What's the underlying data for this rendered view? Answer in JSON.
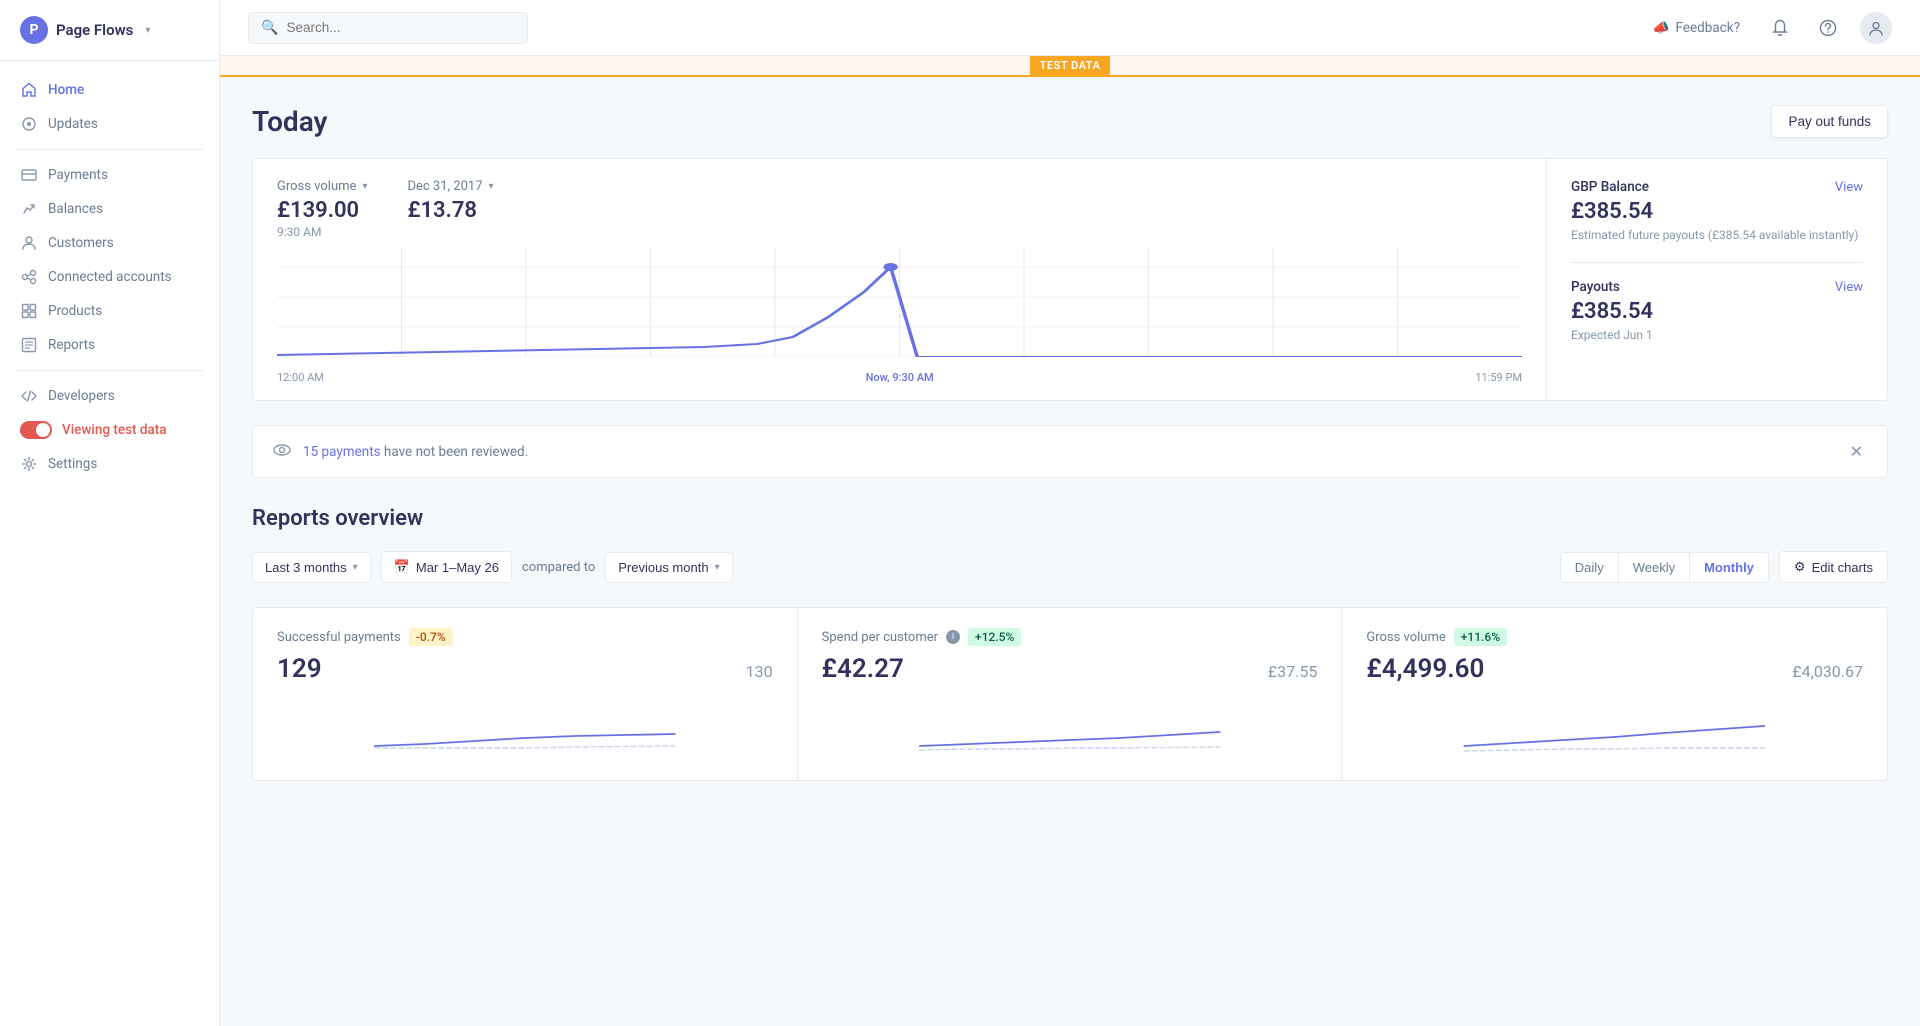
{
  "app": {
    "name": "Page Flows",
    "logo_letter": "P",
    "chevron": "▾"
  },
  "header": {
    "search_placeholder": "Search...",
    "feedback_label": "Feedback?",
    "test_data_badge": "TEST DATA"
  },
  "sidebar": {
    "items": [
      {
        "id": "home",
        "label": "Home",
        "icon": "home",
        "active": true
      },
      {
        "id": "updates",
        "label": "Updates",
        "icon": "updates",
        "active": false
      },
      {
        "id": "payments",
        "label": "Payments",
        "icon": "payments",
        "active": false
      },
      {
        "id": "balances",
        "label": "Balances",
        "icon": "balances",
        "active": false
      },
      {
        "id": "customers",
        "label": "Customers",
        "icon": "customers",
        "active": false
      },
      {
        "id": "connected",
        "label": "Connected accounts",
        "icon": "connected",
        "active": false
      },
      {
        "id": "products",
        "label": "Products",
        "icon": "products",
        "active": false
      },
      {
        "id": "reports",
        "label": "Reports",
        "icon": "reports",
        "active": false
      },
      {
        "id": "developers",
        "label": "Developers",
        "icon": "developers",
        "active": false
      }
    ],
    "viewing_test_data": "Viewing test data",
    "settings": "Settings"
  },
  "today": {
    "title": "Today",
    "pay_out_btn": "Pay out funds",
    "gross_volume_label": "Gross volume",
    "gross_volume_value": "£139.00",
    "gross_volume_time": "9:30 AM",
    "date_label": "Dec 31, 2017",
    "date_value": "£13.78",
    "chart_x_start": "12:00 AM",
    "chart_x_mid": "Now, 9:30 AM",
    "chart_x_end": "11:59 PM",
    "balance_label": "GBP Balance",
    "balance_view": "View",
    "balance_amount": "£385.54",
    "balance_note": "Estimated future payouts (£385.54 available instantly)",
    "payouts_label": "Payouts",
    "payouts_view": "View",
    "payouts_amount": "£385.54",
    "payouts_expected": "Expected Jun 1"
  },
  "notification": {
    "payments_link": "15 payments",
    "text": " have not been reviewed."
  },
  "reports": {
    "title": "Reports overview",
    "filter_period": "Last 3 months",
    "date_range": "Mar 1–May 26",
    "compared_to": "compared to",
    "compare_period": "Previous month",
    "time_daily": "Daily",
    "time_weekly": "Weekly",
    "time_monthly": "Monthly",
    "edit_charts": "Edit charts",
    "cards": [
      {
        "label": "Successful payments",
        "badge": "-0.7%",
        "badge_type": "negative",
        "main_value": "129",
        "compare_value": "130"
      },
      {
        "label": "Spend per customer",
        "badge": "+12.5%",
        "badge_type": "positive",
        "info": true,
        "main_value": "£42.27",
        "compare_value": "£37.55"
      },
      {
        "label": "Gross volume",
        "badge": "+11.6%",
        "badge_type": "positive",
        "main_value": "£4,499.60",
        "compare_value": "£4,030.67"
      }
    ]
  }
}
